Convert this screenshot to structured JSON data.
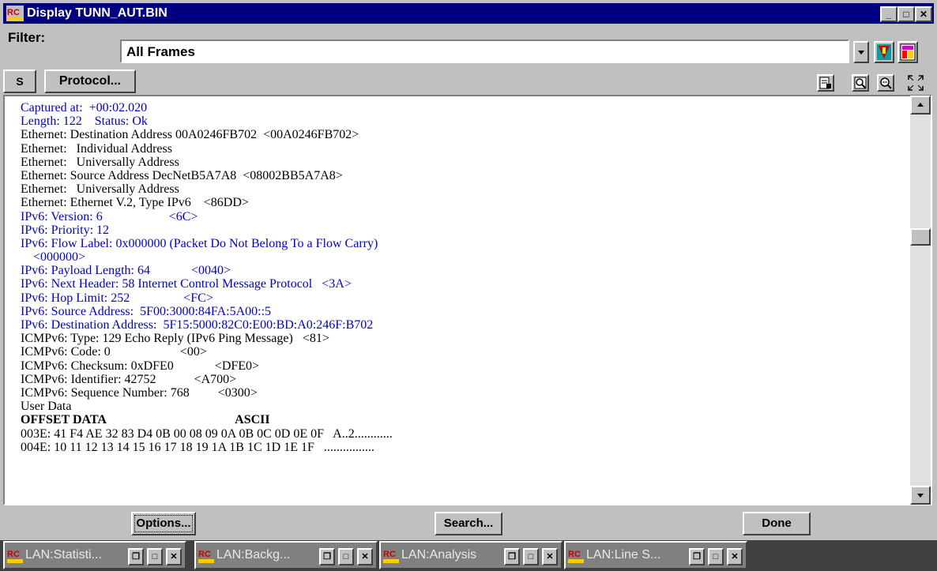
{
  "window": {
    "title": "Display TUNN_AUT.BIN",
    "controls": {
      "minimize": "_",
      "maximize": "□",
      "close": "✕"
    }
  },
  "filter": {
    "label": "Filter:",
    "value": "All Frames"
  },
  "toolbar": {
    "s_label": "S",
    "protocol_label": "Protocol..."
  },
  "detail_lines": [
    {
      "text": "Captured at:  +00:02.020",
      "color": "blue"
    },
    {
      "text": "Length: 122    Status: Ok",
      "color": "blue"
    },
    {
      "text": "Ethernet: Destination Address 00A0246FB702  <00A0246FB702>",
      "color": "black"
    },
    {
      "text": "Ethernet:   Individual Address",
      "color": "black"
    },
    {
      "text": "Ethernet:   Universally Address",
      "color": "black"
    },
    {
      "text": "Ethernet: Source Address DecNetB5A7A8  <08002BB5A7A8>",
      "color": "black"
    },
    {
      "text": "Ethernet:   Universally Address",
      "color": "black"
    },
    {
      "text": "Ethernet: Ethernet V.2, Type IPv6    <86DD>",
      "color": "black"
    },
    {
      "text": "IPv6: Version: 6                     <6C>",
      "color": "blue"
    },
    {
      "text": "IPv6: Priority: 12",
      "color": "blue"
    },
    {
      "text": "IPv6: Flow Label: 0x000000 (Packet Do Not Belong To a Flow Carry)",
      "color": "blue"
    },
    {
      "text": "    <000000>",
      "color": "blue"
    },
    {
      "text": "IPv6: Payload Length: 64             <0040>",
      "color": "blue"
    },
    {
      "text": "IPv6: Next Header: 58 Internet Control Message Protocol   <3A>",
      "color": "blue"
    },
    {
      "text": "IPv6: Hop Limit: 252                 <FC>",
      "color": "blue"
    },
    {
      "text": "IPv6: Source Address:  5F00:3000:84FA:5A00::5",
      "color": "blue"
    },
    {
      "text": "IPv6: Destination Address:  5F15:5000:82C0:E00:BD:A0:246F:B702",
      "color": "blue"
    },
    {
      "text": "ICMPv6: Type: 129 Echo Reply (IPv6 Ping Message)   <81>",
      "color": "black"
    },
    {
      "text": "ICMPv6: Code: 0                      <00>",
      "color": "black"
    },
    {
      "text": "ICMPv6: Checksum: 0xDFE0             <DFE0>",
      "color": "black"
    },
    {
      "text": "ICMPv6: Identifier: 42752            <A700>",
      "color": "black"
    },
    {
      "text": "ICMPv6: Sequence Number: 768         <0300>",
      "color": "black"
    },
    {
      "text": "User Data",
      "color": "black"
    },
    {
      "text": "OFFSET DATA                                         ASCII",
      "color": "black",
      "bold": true
    },
    {
      "text": "003E: 41 F4 AE 32 83 D4 0B 00 08 09 0A 0B 0C 0D 0E 0F   A..2............",
      "color": "black"
    },
    {
      "text": "004E: 10 11 12 13 14 15 16 17 18 19 1A 1B 1C 1D 1E 1F   ................",
      "color": "black"
    }
  ],
  "buttons": {
    "options": "Options...",
    "search": "Search...",
    "done": "Done"
  },
  "taskbar": [
    {
      "label": "LAN:Statisti..."
    },
    {
      "label": "LAN:Backg..."
    },
    {
      "label": "LAN:Analysis"
    },
    {
      "label": "LAN:Line S..."
    }
  ],
  "colors": {
    "title_bar": "#000080",
    "detail_blue": "#0000cc",
    "window_bg": "#c0c0c0"
  },
  "icons": {
    "app_logo": "rc-logo-icon",
    "filter_tools": [
      "filter-edit-icon",
      "filter-new-icon"
    ],
    "view_tools": [
      "view-detail-icon",
      "zoom-in-icon",
      "zoom-out-icon",
      "fullscreen-icon"
    ]
  }
}
